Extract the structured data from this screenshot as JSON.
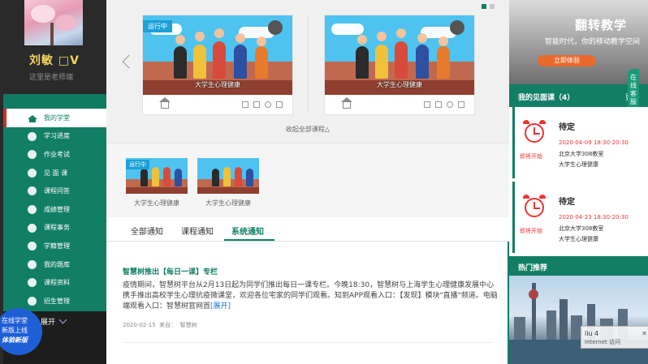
{
  "user": {
    "name": "刘敏 □V",
    "motto": "这里是老师端"
  },
  "sidebar": {
    "items": [
      {
        "label": "我的学堂",
        "icon": "home-icon"
      },
      {
        "label": "学习进度",
        "icon": "progress-icon"
      },
      {
        "label": "作业考试",
        "icon": "exam-icon"
      },
      {
        "label": "见 面 课",
        "icon": "meeting-icon"
      },
      {
        "label": "课程问答",
        "icon": "qa-icon"
      },
      {
        "label": "成绩管理",
        "icon": "grade-icon"
      },
      {
        "label": "课程事务",
        "icon": "affairs-icon"
      },
      {
        "label": "学籍管理",
        "icon": "student-record-icon"
      },
      {
        "label": "我的题库",
        "icon": "question-bank-icon"
      },
      {
        "label": "课程资料",
        "icon": "materials-icon"
      },
      {
        "label": "招生管理",
        "icon": "enroll-icon"
      }
    ],
    "expand_label": "展开",
    "float_badge": {
      "line1": "在线学堂",
      "line2": "新版上线",
      "line3": "体验新版"
    }
  },
  "carousel": {
    "cards": [
      {
        "badge": "运行中",
        "title": "大学生心理健康"
      },
      {
        "badge": "",
        "title": "大学生心理健康"
      }
    ],
    "collapse_label": "收起全部课程△"
  },
  "mini_courses": [
    {
      "badge": "运行中",
      "title": "大学生心理健康"
    },
    {
      "badge": "",
      "title": "大学生心理健康"
    }
  ],
  "tabs": [
    {
      "label": "全部通知"
    },
    {
      "label": "课程通知"
    },
    {
      "label": "系统通知"
    }
  ],
  "notice": {
    "title": "智慧树推出【每日一课】专栏",
    "body": "疫情期间，智慧树平台从2月13日起为同学们推出每日一课专栏。今晚18:30，智慧树与上海学生心理健康发展中心携手推出高校学生心理抗疫微课堂，欢迎各位宅家的同学们观看。知到APP观看入口：【发现】模块\"直播\"频道。电脑端观看入口：智慧树官网首",
    "more": "[展开]",
    "date": "2020-02-15",
    "source_label": "来自：",
    "source": "智慧树"
  },
  "right": {
    "banner": {
      "title": "翻转教学",
      "subtitle": "智能时代，你的移动教学空间",
      "button": "立即体验"
    },
    "meeting_header": "我的见面课（4）",
    "more_label": "更多",
    "feedback_tab": "在线客服",
    "courses": [
      {
        "status": "待定",
        "soon": "即将开始",
        "time": "2020-04-09 18:30-20:30",
        "room": "北京大学308教室",
        "name": "大学生心理健康"
      },
      {
        "status": "待定",
        "soon": "即将开始",
        "time": "2020-04-23 18:30-20:30",
        "room": "北京大学308教室",
        "name": "大学生心理健康"
      }
    ],
    "hot_header": "热门推荐",
    "widget": {
      "line1": "liu 4",
      "line2": "Internet 访问"
    }
  },
  "colors": {
    "accent": "#127e66",
    "alert": "#e33333",
    "highlight": "#f4d35e",
    "link": "#1d6fd8"
  }
}
